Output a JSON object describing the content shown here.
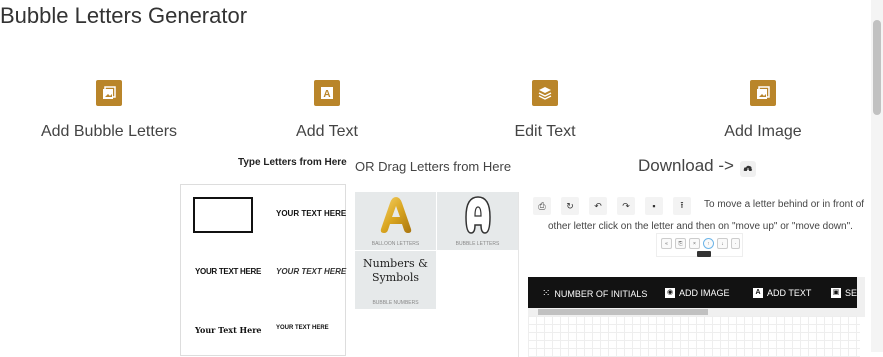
{
  "page": {
    "title": "Bubble Letters Generator"
  },
  "steps": [
    {
      "label": "Add Bubble Letters",
      "icon": "image-icon"
    },
    {
      "label": "Add Text",
      "icon": "text-icon"
    },
    {
      "label": "Edit Text",
      "icon": "layers-icon"
    },
    {
      "label": "Add Image",
      "icon": "image-icon"
    }
  ],
  "labels": {
    "type_letters": "Type Letters from Here",
    "drag_letters": "OR Drag Letters from Here",
    "download": "Download ->"
  },
  "text_styles": [
    "YOUR TEXT HERE",
    "YOUR TEXT HERE",
    "YOUR TEXT HERE",
    "Your Text Here",
    "YOUR TEXT HERE"
  ],
  "letter_tiles": [
    {
      "caption": "BALLOON LETTERS",
      "glyph": "A"
    },
    {
      "caption": "BUBBLE LETTERS",
      "glyph": "A"
    },
    {
      "caption": "BUBBLE NUMBERS",
      "text": "Numbers & Symbols"
    }
  ],
  "toolbar": {
    "buttons": [
      "print-icon",
      "reset-icon",
      "undo-icon",
      "redo-icon",
      "save-icon",
      "upload-icon"
    ],
    "hint_line1": "To move a letter behind or in front of",
    "hint_line2": "other letter click on the letter and then on \"move up\" or \"move down\"."
  },
  "editor": {
    "number_of_initials": "NUMBER OF INITIALS",
    "add_image": "ADD IMAGE",
    "add_text": "ADD TEXT",
    "more": "SE"
  },
  "colors": {
    "accent": "#b9852a",
    "editor_bar": "#121212"
  }
}
